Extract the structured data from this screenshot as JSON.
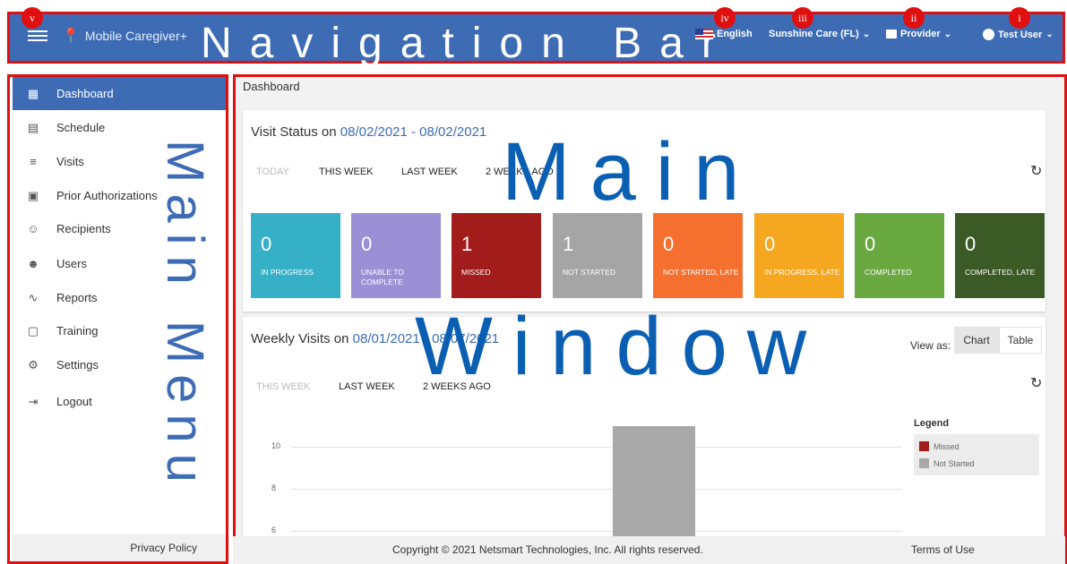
{
  "navbar": {
    "brand": "Mobile Caregiver+",
    "overlay_label": "Navigation Bar",
    "language": "English",
    "agency": "Sunshine Care (FL)",
    "role": "Provider",
    "user": "Test User",
    "badges": [
      "v",
      "iv",
      "iii",
      "ii",
      "i"
    ]
  },
  "sidebar": {
    "overlay_label": "Main Menu",
    "items": [
      {
        "label": "Dashboard",
        "icon": "dashboard-icon",
        "active": true
      },
      {
        "label": "Schedule",
        "icon": "calendar-icon"
      },
      {
        "label": "Visits",
        "icon": "filter-list-icon"
      },
      {
        "label": "Prior Authorizations",
        "icon": "calendar-day-icon"
      },
      {
        "label": "Recipients",
        "icon": "people-outline-icon"
      },
      {
        "label": "Users",
        "icon": "people-icon"
      },
      {
        "label": "Reports",
        "icon": "trend-line-icon"
      },
      {
        "label": "Training",
        "icon": "training-icon"
      },
      {
        "label": "Settings",
        "icon": "gear-icon"
      },
      {
        "label": "Logout",
        "icon": "logout-icon"
      }
    ],
    "privacy": "Privacy Policy"
  },
  "main": {
    "overlay_line1": "Main",
    "overlay_line2": "Window",
    "breadcrumb": "Dashboard",
    "visit_status": {
      "title": "Visit Status on ",
      "date": "08/02/2021 - 08/02/2021",
      "tabs": [
        "TODAY",
        "THIS WEEK",
        "LAST WEEK",
        "2 WEEKS AGO"
      ],
      "tiles": [
        {
          "value": "0",
          "label": "IN PROGRESS",
          "color": "#35b0c6"
        },
        {
          "value": "0",
          "label": "UNABLE TO COMPLETE",
          "color": "#9b8fd6"
        },
        {
          "value": "1",
          "label": "MISSED",
          "color": "#a21c1c"
        },
        {
          "value": "1",
          "label": "NOT STARTED",
          "color": "#a5a5a5"
        },
        {
          "value": "0",
          "label": "NOT STARTED, LATE",
          "color": "#f5702f"
        },
        {
          "value": "0",
          "label": "IN PROGRESS, LATE",
          "color": "#f6a720"
        },
        {
          "value": "0",
          "label": "COMPLETED",
          "color": "#6aa840"
        },
        {
          "value": "0",
          "label": "COMPLETED, LATE",
          "color": "#3c5a25"
        }
      ]
    },
    "weekly_visits": {
      "title": "Weekly Visits on ",
      "date": "08/01/2021 - 08/07/2021",
      "view_as": "View as:",
      "view_options": [
        "Chart",
        "Table"
      ],
      "tabs": [
        "THIS WEEK",
        "LAST WEEK",
        "2 WEEKS AGO"
      ],
      "legend_title": "Legend",
      "legend": [
        {
          "label": "Missed",
          "color": "#a21c1c"
        },
        {
          "label": "Not Started",
          "color": "#a9a9a9"
        }
      ]
    }
  },
  "chart_data": {
    "type": "bar",
    "y_ticks_visible": [
      "10",
      "8",
      "6"
    ],
    "series": [
      {
        "name": "Missed",
        "values": [
          0,
          0,
          0,
          0,
          0,
          0,
          0
        ]
      },
      {
        "name": "Not Started",
        "values": [
          0,
          0,
          0,
          11,
          0,
          0,
          0
        ]
      }
    ],
    "ylim_visible": [
      6,
      11
    ]
  },
  "footer": {
    "copyright": "Copyright © 2021 Netsmart Technologies, Inc. All rights reserved.",
    "terms": "Terms of Use"
  }
}
